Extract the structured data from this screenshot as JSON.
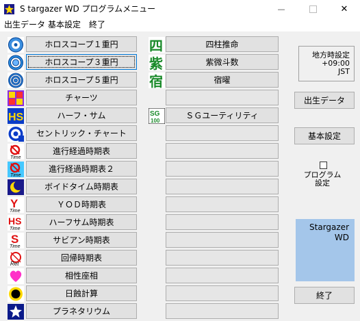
{
  "window": {
    "title": "S targazer WD プログラムメニュー",
    "minimize_glyph": "—",
    "close_glyph": "✕"
  },
  "menu": [
    "出生データ",
    "基本設定",
    "終了"
  ],
  "left_buttons": [
    {
      "label": "ホロスコープ１重円",
      "icon": "horoscope-single-wheel-icon"
    },
    {
      "label": "ホロスコープ３重円",
      "icon": "horoscope-triple-wheel-icon"
    },
    {
      "label": "ホロスコープ５重円",
      "icon": "horoscope-five-wheel-icon"
    },
    {
      "label": "チャーツ",
      "icon": "charts-icon"
    },
    {
      "label": "ハーフ・サム",
      "icon": "half-sum-icon",
      "icon_text": "HS"
    },
    {
      "label": "セントリック・チャート",
      "icon": "centric-chart-icon"
    },
    {
      "label": "進行経過時期表",
      "icon": "progression-timetable-icon",
      "icon_text": "Time"
    },
    {
      "label": "進行経過時期表２",
      "icon": "progression-timetable-2-icon",
      "icon_text": "Time"
    },
    {
      "label": "ボイドタイム時期表",
      "icon": "void-time-icon"
    },
    {
      "label": "ＹＯＤ時期表",
      "icon": "yod-time-icon",
      "icon_text": "Y"
    },
    {
      "label": "ハーフサム時期表",
      "icon": "half-sum-time-icon",
      "icon_text": "HS"
    },
    {
      "label": "サビアン時期表",
      "icon": "sabian-time-icon",
      "icon_text": "S"
    },
    {
      "label": "回帰時期表",
      "icon": "return-time-icon",
      "icon_text": "Ret"
    },
    {
      "label": "相性座相",
      "icon": "compatibility-heart-icon"
    },
    {
      "label": "日蝕計算",
      "icon": "eclipse-icon"
    },
    {
      "label": "プラネタリウム",
      "icon": "planetarium-icon"
    }
  ],
  "right_buttons": [
    {
      "label": "四柱推命",
      "icon": "four-pillars-icon",
      "icon_text": "四"
    },
    {
      "label": "紫微斗数",
      "icon": "ziwei-icon",
      "icon_text": "紫"
    },
    {
      "label": "宿曜",
      "icon": "sukuyo-icon",
      "icon_text": "宿"
    },
    {
      "label": "",
      "icon": ""
    },
    {
      "label": "ＳＧユーティリティ",
      "icon": "sg-utility-icon",
      "icon_text": "SG100"
    },
    {
      "label": "",
      "icon": ""
    },
    {
      "label": "",
      "icon": ""
    },
    {
      "label": "",
      "icon": ""
    },
    {
      "label": "",
      "icon": ""
    },
    {
      "label": "",
      "icon": ""
    },
    {
      "label": "",
      "icon": ""
    },
    {
      "label": "",
      "icon": ""
    },
    {
      "label": "",
      "icon": ""
    },
    {
      "label": "",
      "icon": ""
    },
    {
      "label": "",
      "icon": ""
    },
    {
      "label": "",
      "icon": ""
    }
  ],
  "side": {
    "timezone": [
      "地方時設定",
      "+09:00",
      "JST"
    ],
    "birth_data_button": "出生データ",
    "settings_button": "基本設定",
    "program_settings_label": [
      "プログラム",
      "設定"
    ],
    "program_settings_checked": false,
    "brand": [
      "Stargazer",
      "WD"
    ],
    "exit_button": "終了"
  }
}
